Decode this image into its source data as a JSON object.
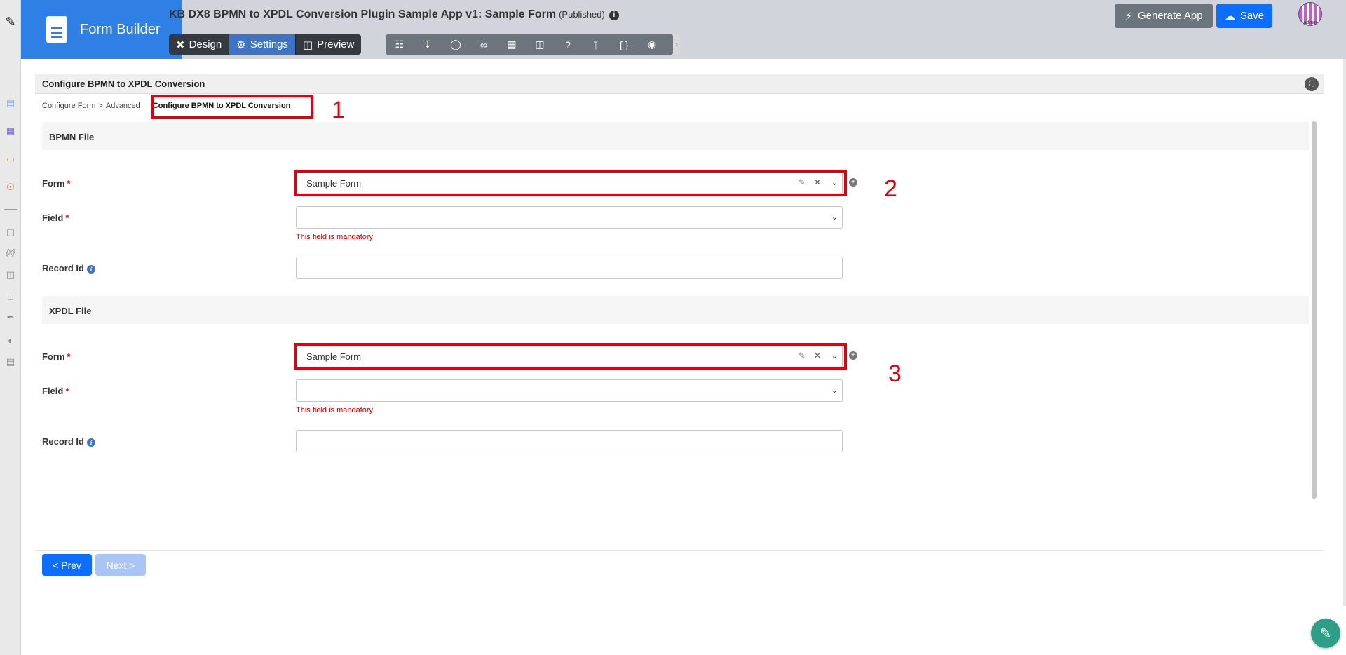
{
  "app": {
    "brand_label": "Form Builder",
    "title": "KB DX8 BPMN to XPDL Conversion Plugin Sample App v1: Sample Form",
    "status": "(Published)"
  },
  "modes": [
    {
      "label": "Design",
      "icon": "design-icon"
    },
    {
      "label": "Settings",
      "icon": "gear-icon",
      "active": true
    },
    {
      "label": "Preview",
      "icon": "preview-icon"
    }
  ],
  "toolbar_icons": [
    "tree-icon",
    "import-icon",
    "lock-icon",
    "binoculars-icon",
    "grid-icon",
    "translate-icon",
    "help-icon",
    "branch-icon",
    "braces-icon",
    "camera-icon"
  ],
  "actions": {
    "generate_label": "Generate App",
    "save_label": "Save"
  },
  "user": {
    "avatar_text": "admin"
  },
  "panel": {
    "title": "Configure BPMN to XPDL Conversion",
    "breadcrumb": [
      "Configure Form",
      "Advanced"
    ],
    "breadcrumb_sep": ">",
    "current": "Configure BPMN to XPDL Conversion"
  },
  "annotations": [
    "1",
    "2",
    "3"
  ],
  "bpmn": {
    "section": "BPMN File",
    "form_label": "Form",
    "form_value": "Sample Form",
    "field_label": "Field",
    "field_value": "",
    "field_error": "This field is mandatory",
    "record_label": "Record Id"
  },
  "xpdl": {
    "section": "XPDL File",
    "form_label": "Form",
    "form_value": "Sample Form",
    "field_label": "Field",
    "field_value": "",
    "field_error": "This field is mandatory",
    "record_label": "Record Id"
  },
  "required_mark": "*",
  "nav": {
    "prev_label": "< Prev",
    "next_label": "Next >"
  },
  "colors": {
    "brand": "#2f7fe4",
    "primary": "#0d6efd",
    "annotation": "#e3000e",
    "error": "#c00000"
  }
}
